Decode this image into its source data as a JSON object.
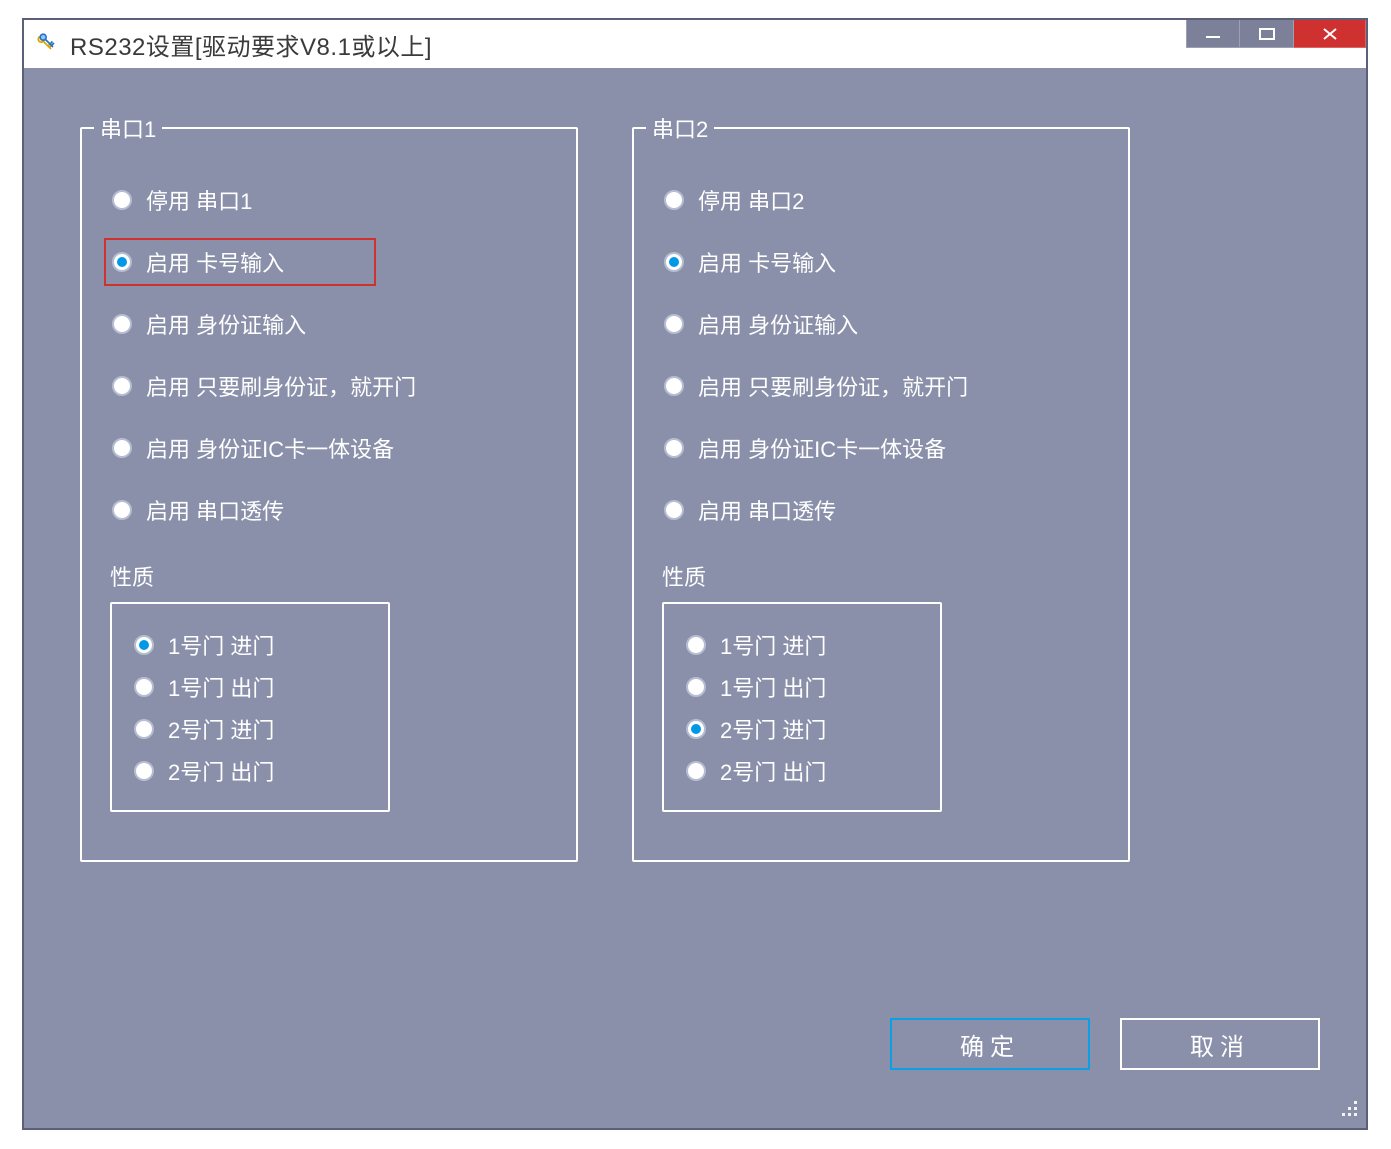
{
  "window": {
    "title": "RS232设置[驱动要求V8.1或以上]"
  },
  "port1": {
    "legend": "串口1",
    "options": [
      {
        "label": "停用 串口1",
        "selected": false,
        "highlight": false
      },
      {
        "label": "启用 卡号输入",
        "selected": true,
        "highlight": true
      },
      {
        "label": "启用 身份证输入",
        "selected": false,
        "highlight": false
      },
      {
        "label": "启用 只要刷身份证，就开门",
        "selected": false,
        "highlight": false
      },
      {
        "label": "启用 身份证IC卡一体设备",
        "selected": false,
        "highlight": false
      },
      {
        "label": "启用 串口透传",
        "selected": false,
        "highlight": false
      }
    ],
    "property_label": "性质",
    "property_options": [
      {
        "label": "1号门 进门",
        "selected": true
      },
      {
        "label": "1号门 出门",
        "selected": false
      },
      {
        "label": "2号门 进门",
        "selected": false
      },
      {
        "label": "2号门 出门",
        "selected": false
      }
    ]
  },
  "port2": {
    "legend": "串口2",
    "options": [
      {
        "label": "停用 串口2",
        "selected": false,
        "highlight": false
      },
      {
        "label": "启用 卡号输入",
        "selected": true,
        "highlight": false
      },
      {
        "label": "启用 身份证输入",
        "selected": false,
        "highlight": false
      },
      {
        "label": "启用 只要刷身份证，就开门",
        "selected": false,
        "highlight": false
      },
      {
        "label": "启用 身份证IC卡一体设备",
        "selected": false,
        "highlight": false
      },
      {
        "label": "启用 串口透传",
        "selected": false,
        "highlight": false
      }
    ],
    "property_label": "性质",
    "property_options": [
      {
        "label": "1号门 进门",
        "selected": false
      },
      {
        "label": "1号门 出门",
        "selected": false
      },
      {
        "label": "2号门 进门",
        "selected": true
      },
      {
        "label": "2号门 出门",
        "selected": false
      }
    ]
  },
  "buttons": {
    "ok": "确定",
    "cancel": "取消"
  }
}
